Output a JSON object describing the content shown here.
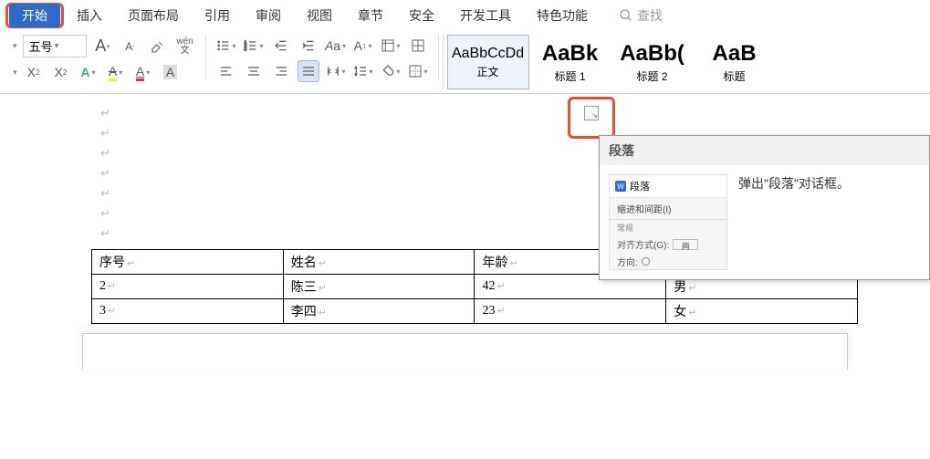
{
  "tabs": [
    "开始",
    "插入",
    "页面布局",
    "引用",
    "审阅",
    "视图",
    "章节",
    "安全",
    "开发工具",
    "特色功能"
  ],
  "active_tab_index": 0,
  "search_placeholder": "查找",
  "ribbon": {
    "font_size": "五号",
    "big_a": "A",
    "small_a": "A",
    "ruby_top": "wén",
    "ruby_bottom": "文",
    "font_color_a": "A",
    "highlight_a": "A",
    "shading_a": "A"
  },
  "styles": [
    {
      "preview": "AaBbCcDd",
      "label": "正文",
      "big": false,
      "active": true
    },
    {
      "preview": "AaBk",
      "label": "标题 1",
      "big": true,
      "active": false
    },
    {
      "preview": "AaBb(",
      "label": "标题 2",
      "big": true,
      "active": false
    },
    {
      "preview": "AaB",
      "label": "标题",
      "big": true,
      "active": false
    }
  ],
  "tooltip": {
    "title": "段落",
    "desc": "弹出\"段落\"对话框。",
    "thumb": {
      "dialog_title": "段落",
      "tab": "缩进和间距(I)",
      "section": "常规",
      "align_label": "对齐方式(G):",
      "align_value": "两",
      "dir_label": "方向:"
    }
  },
  "table": {
    "headers": [
      "序号",
      "姓名",
      "年龄"
    ],
    "rows": [
      [
        "2",
        "陈三",
        "42",
        "男"
      ],
      [
        "3",
        "李四",
        "23",
        "女"
      ]
    ]
  }
}
